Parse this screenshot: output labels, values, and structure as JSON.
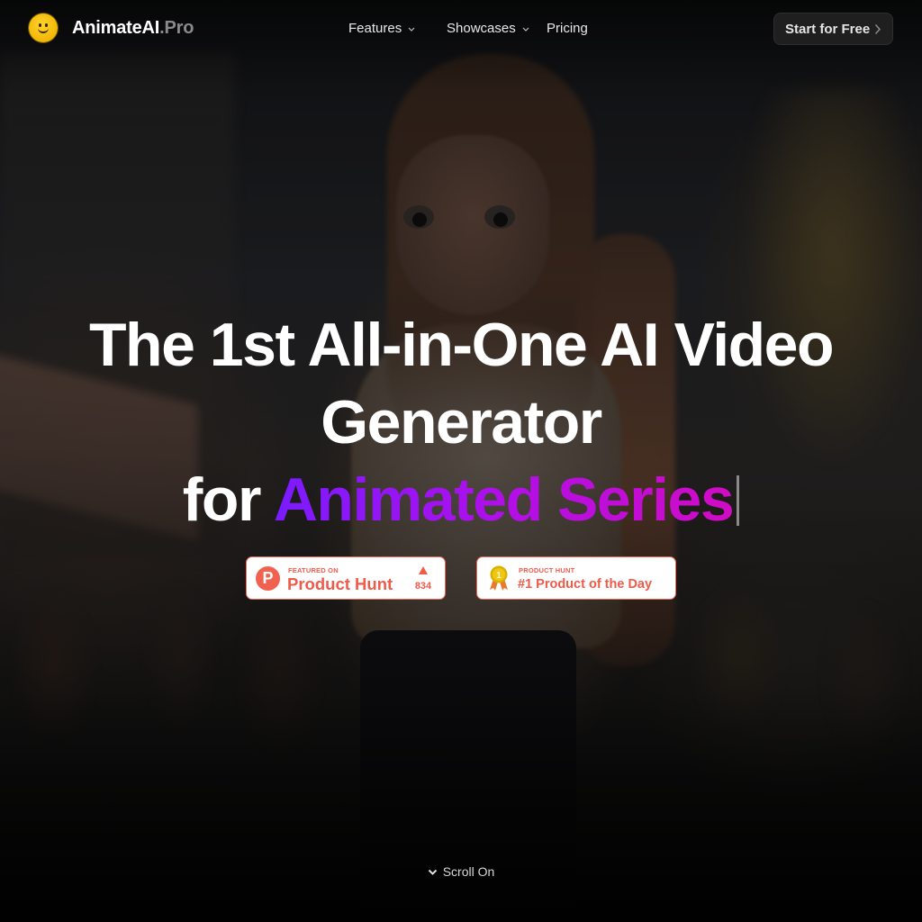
{
  "header": {
    "brand": {
      "name": "AnimateAI",
      "suffix": ".Pro",
      "logo_icon": "smiley-face-icon"
    },
    "nav": [
      {
        "label": "Features",
        "has_dropdown": true
      },
      {
        "label": "Showcases",
        "has_dropdown": true
      },
      {
        "label": "Pricing",
        "has_dropdown": false
      }
    ],
    "cta_label": "Start for Free"
  },
  "hero": {
    "title_line1": "The 1st All-in-One AI Video",
    "title_line2": "Generator",
    "title_line3_prefix": "for",
    "title_line3_highlight": "Animated Series",
    "highlight_gradient": [
      "#7a1bff",
      "#b10fe8",
      "#d00cc4"
    ]
  },
  "badges": {
    "featured": {
      "kicker": "FEATURED ON",
      "title": "Product Hunt",
      "logo_letter": "P",
      "upvotes": "834"
    },
    "product_of_day": {
      "kicker": "PRODUCT HUNT",
      "title": "#1 Product of the Day",
      "medal_number": "1"
    },
    "accent_color": "#ef5a4a"
  },
  "scroll": {
    "label": "Scroll On"
  }
}
